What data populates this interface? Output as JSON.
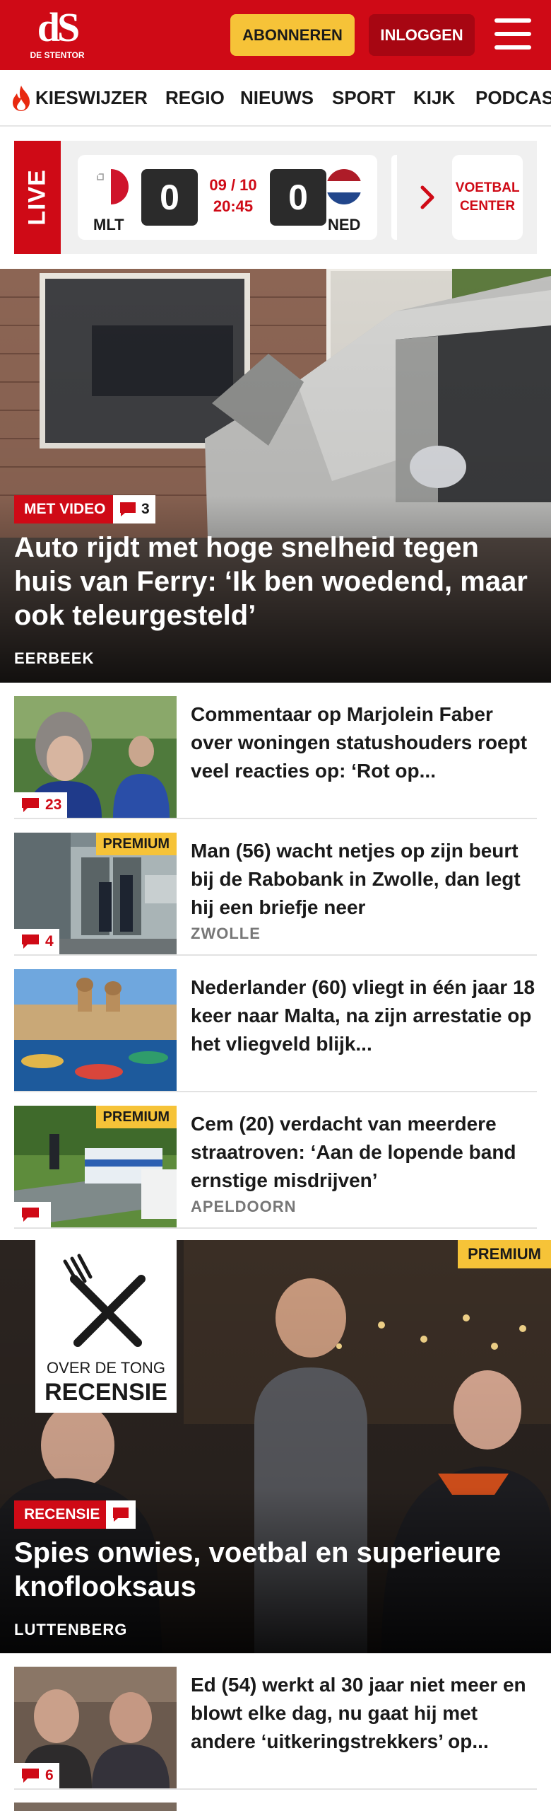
{
  "header": {
    "logo_mark": "dS",
    "logo_text": "DE STENTOR",
    "subscribe_label": "ABONNEREN",
    "login_label": "INLOGGEN",
    "brand_color": "#cf0a16",
    "accent_color": "#f6c338"
  },
  "nav": {
    "items": [
      "KIESWIJZER",
      "REGIO",
      "NIEUWS",
      "SPORT",
      "KIJK",
      "PODCAS"
    ]
  },
  "live": {
    "label": "LIVE",
    "match": {
      "home_code": "MLT",
      "away_code": "NED",
      "home_score": "0",
      "away_score": "0",
      "date": "09 / 10",
      "time": "20:45"
    },
    "voetbal_center_label": "VOETBAL CENTER"
  },
  "hero": {
    "badge": "MET VIDEO",
    "comments": "3",
    "title": "Auto rijdt met hoge snelheid tegen huis van Ferry: ‘Ik ben woedend, maar ook teleurgesteld’",
    "kicker": "EERBEEK"
  },
  "articles": [
    {
      "title": "Commentaar op Marjolein Faber over woningen statushouders roept veel reacties op: ‘Rot op...",
      "comments": "23",
      "premium": "",
      "kicker": ""
    },
    {
      "title": "Man (56) wacht netjes op zijn beurt bij de Rabobank in Zwolle, dan legt hij een briefje neer",
      "comments": "4",
      "premium": "PREMIUM",
      "kicker": "ZWOLLE"
    },
    {
      "title": "Nederlander (60) vliegt in één jaar 18 keer naar Malta, na zijn arrestatie op het vliegveld blijk...",
      "comments": "",
      "premium": "",
      "kicker": ""
    },
    {
      "title": "Cem (20) verdacht van meerdere straatroven: ‘Aan de lopende band ernstige misdrijven’",
      "comments": "",
      "premium": "PREMIUM",
      "kicker": "APELDOORN"
    }
  ],
  "feature": {
    "premium": "PREMIUM",
    "logo_line1": "OVER DE TONG",
    "logo_line2": "RECENSIE",
    "badge": "RECENSIE",
    "title": "Spies onwies, voetbal en superieure knoflooksaus",
    "kicker": "LUTTENBERG"
  },
  "bottom_article": {
    "title": "Ed (54) werkt al 30 jaar niet meer en blowt elke dag, nu gaat hij met andere ‘uitkeringstrekkers’ op...",
    "comments": "6"
  }
}
